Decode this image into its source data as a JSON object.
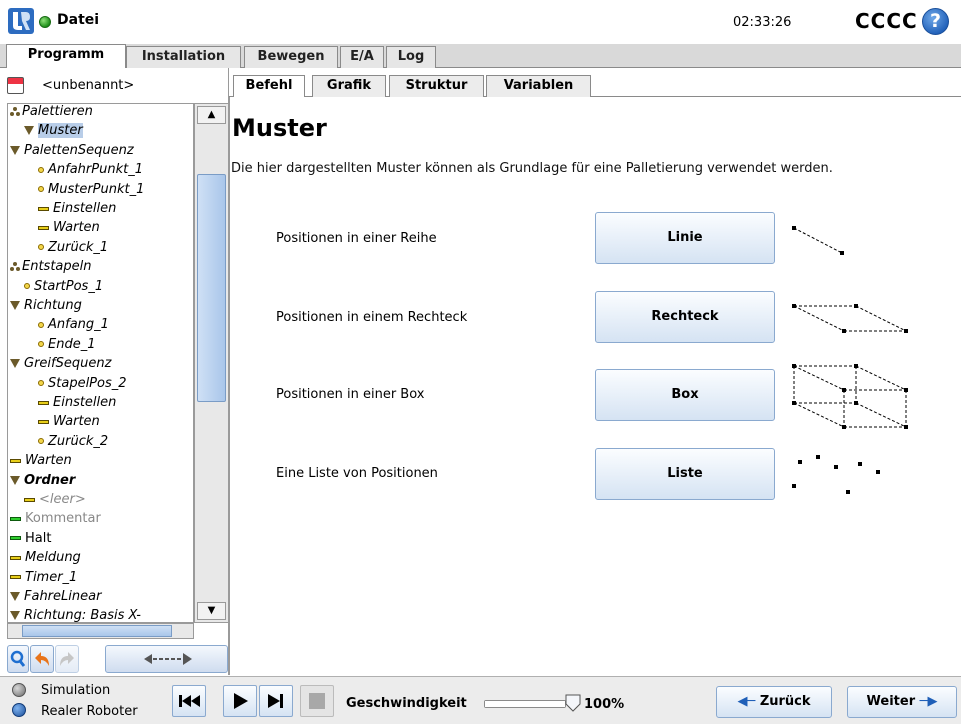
{
  "header": {
    "file_menu": "Datei",
    "clock": "02:33:26",
    "robot_name": "CCCC",
    "help": "?"
  },
  "main_tabs": [
    "Programm",
    "Installation",
    "Bewegen",
    "E/A",
    "Log"
  ],
  "program": {
    "name": "<unbenannt>"
  },
  "tree": [
    {
      "label": "Palettieren",
      "icon": "pallet-icon"
    },
    {
      "label": "Muster",
      "icon": "triangle-icon",
      "selected": true
    },
    {
      "label": "PalettenSequenz",
      "icon": "triangle-icon"
    },
    {
      "label": "AnfahrPunkt_1",
      "icon": "waypoint-icon"
    },
    {
      "label": "MusterPunkt_1",
      "icon": "waypoint-icon"
    },
    {
      "label": "Einstellen",
      "icon": "bar-icon"
    },
    {
      "label": "Warten",
      "icon": "bar-icon"
    },
    {
      "label": "Zurück_1",
      "icon": "waypoint-icon"
    },
    {
      "label": "Entstapeln",
      "icon": "pallet-icon"
    },
    {
      "label": "StartPos_1",
      "icon": "waypoint-icon"
    },
    {
      "label": "Richtung",
      "icon": "triangle-icon"
    },
    {
      "label": "Anfang_1",
      "icon": "waypoint-icon"
    },
    {
      "label": "Ende_1",
      "icon": "waypoint-icon"
    },
    {
      "label": "GreifSequenz",
      "icon": "triangle-icon"
    },
    {
      "label": "StapelPos_2",
      "icon": "waypoint-icon"
    },
    {
      "label": "Einstellen",
      "icon": "bar-icon"
    },
    {
      "label": "Warten",
      "icon": "bar-icon"
    },
    {
      "label": "Zurück_2",
      "icon": "waypoint-icon"
    },
    {
      "label": "Warten",
      "icon": "bar-icon"
    },
    {
      "label": "Ordner",
      "icon": "triangle-icon"
    },
    {
      "label": "<leer>",
      "icon": "bar-icon"
    },
    {
      "label": "Kommentar",
      "icon": "green-bar-icon"
    },
    {
      "label": "Halt",
      "icon": "green-bar-icon"
    },
    {
      "label": "Meldung",
      "icon": "bar-icon"
    },
    {
      "label": "Timer_1",
      "icon": "bar-icon"
    },
    {
      "label": "FahreLinear",
      "icon": "triangle-icon"
    },
    {
      "label": "Richtung: Basis X-",
      "icon": "triangle-icon"
    }
  ],
  "content_tabs": [
    "Befehl",
    "Grafik",
    "Struktur",
    "Variablen"
  ],
  "content": {
    "title": "Muster",
    "description": "Die hier dargestellten Muster können als Grundlage für eine Palletierung verwendet werden.",
    "rows": [
      {
        "label": "Positionen in einer Reihe",
        "button": "Linie"
      },
      {
        "label": "Positionen in einem Rechteck",
        "button": "Rechteck"
      },
      {
        "label": "Positionen in einer Box",
        "button": "Box"
      },
      {
        "label": "Eine Liste von Positionen",
        "button": "Liste"
      }
    ]
  },
  "bottom": {
    "simulation": "Simulation",
    "real_robot": "Realer Roboter",
    "speed_label": "Geschwindigkeit",
    "speed_value": "100%",
    "speed_fraction": 1.0,
    "back": "Zurück",
    "next": "Weiter"
  },
  "colors": {
    "accent": "#1f5fb8",
    "status_green": "#1f8f1a",
    "selection": "#b8cde8"
  }
}
